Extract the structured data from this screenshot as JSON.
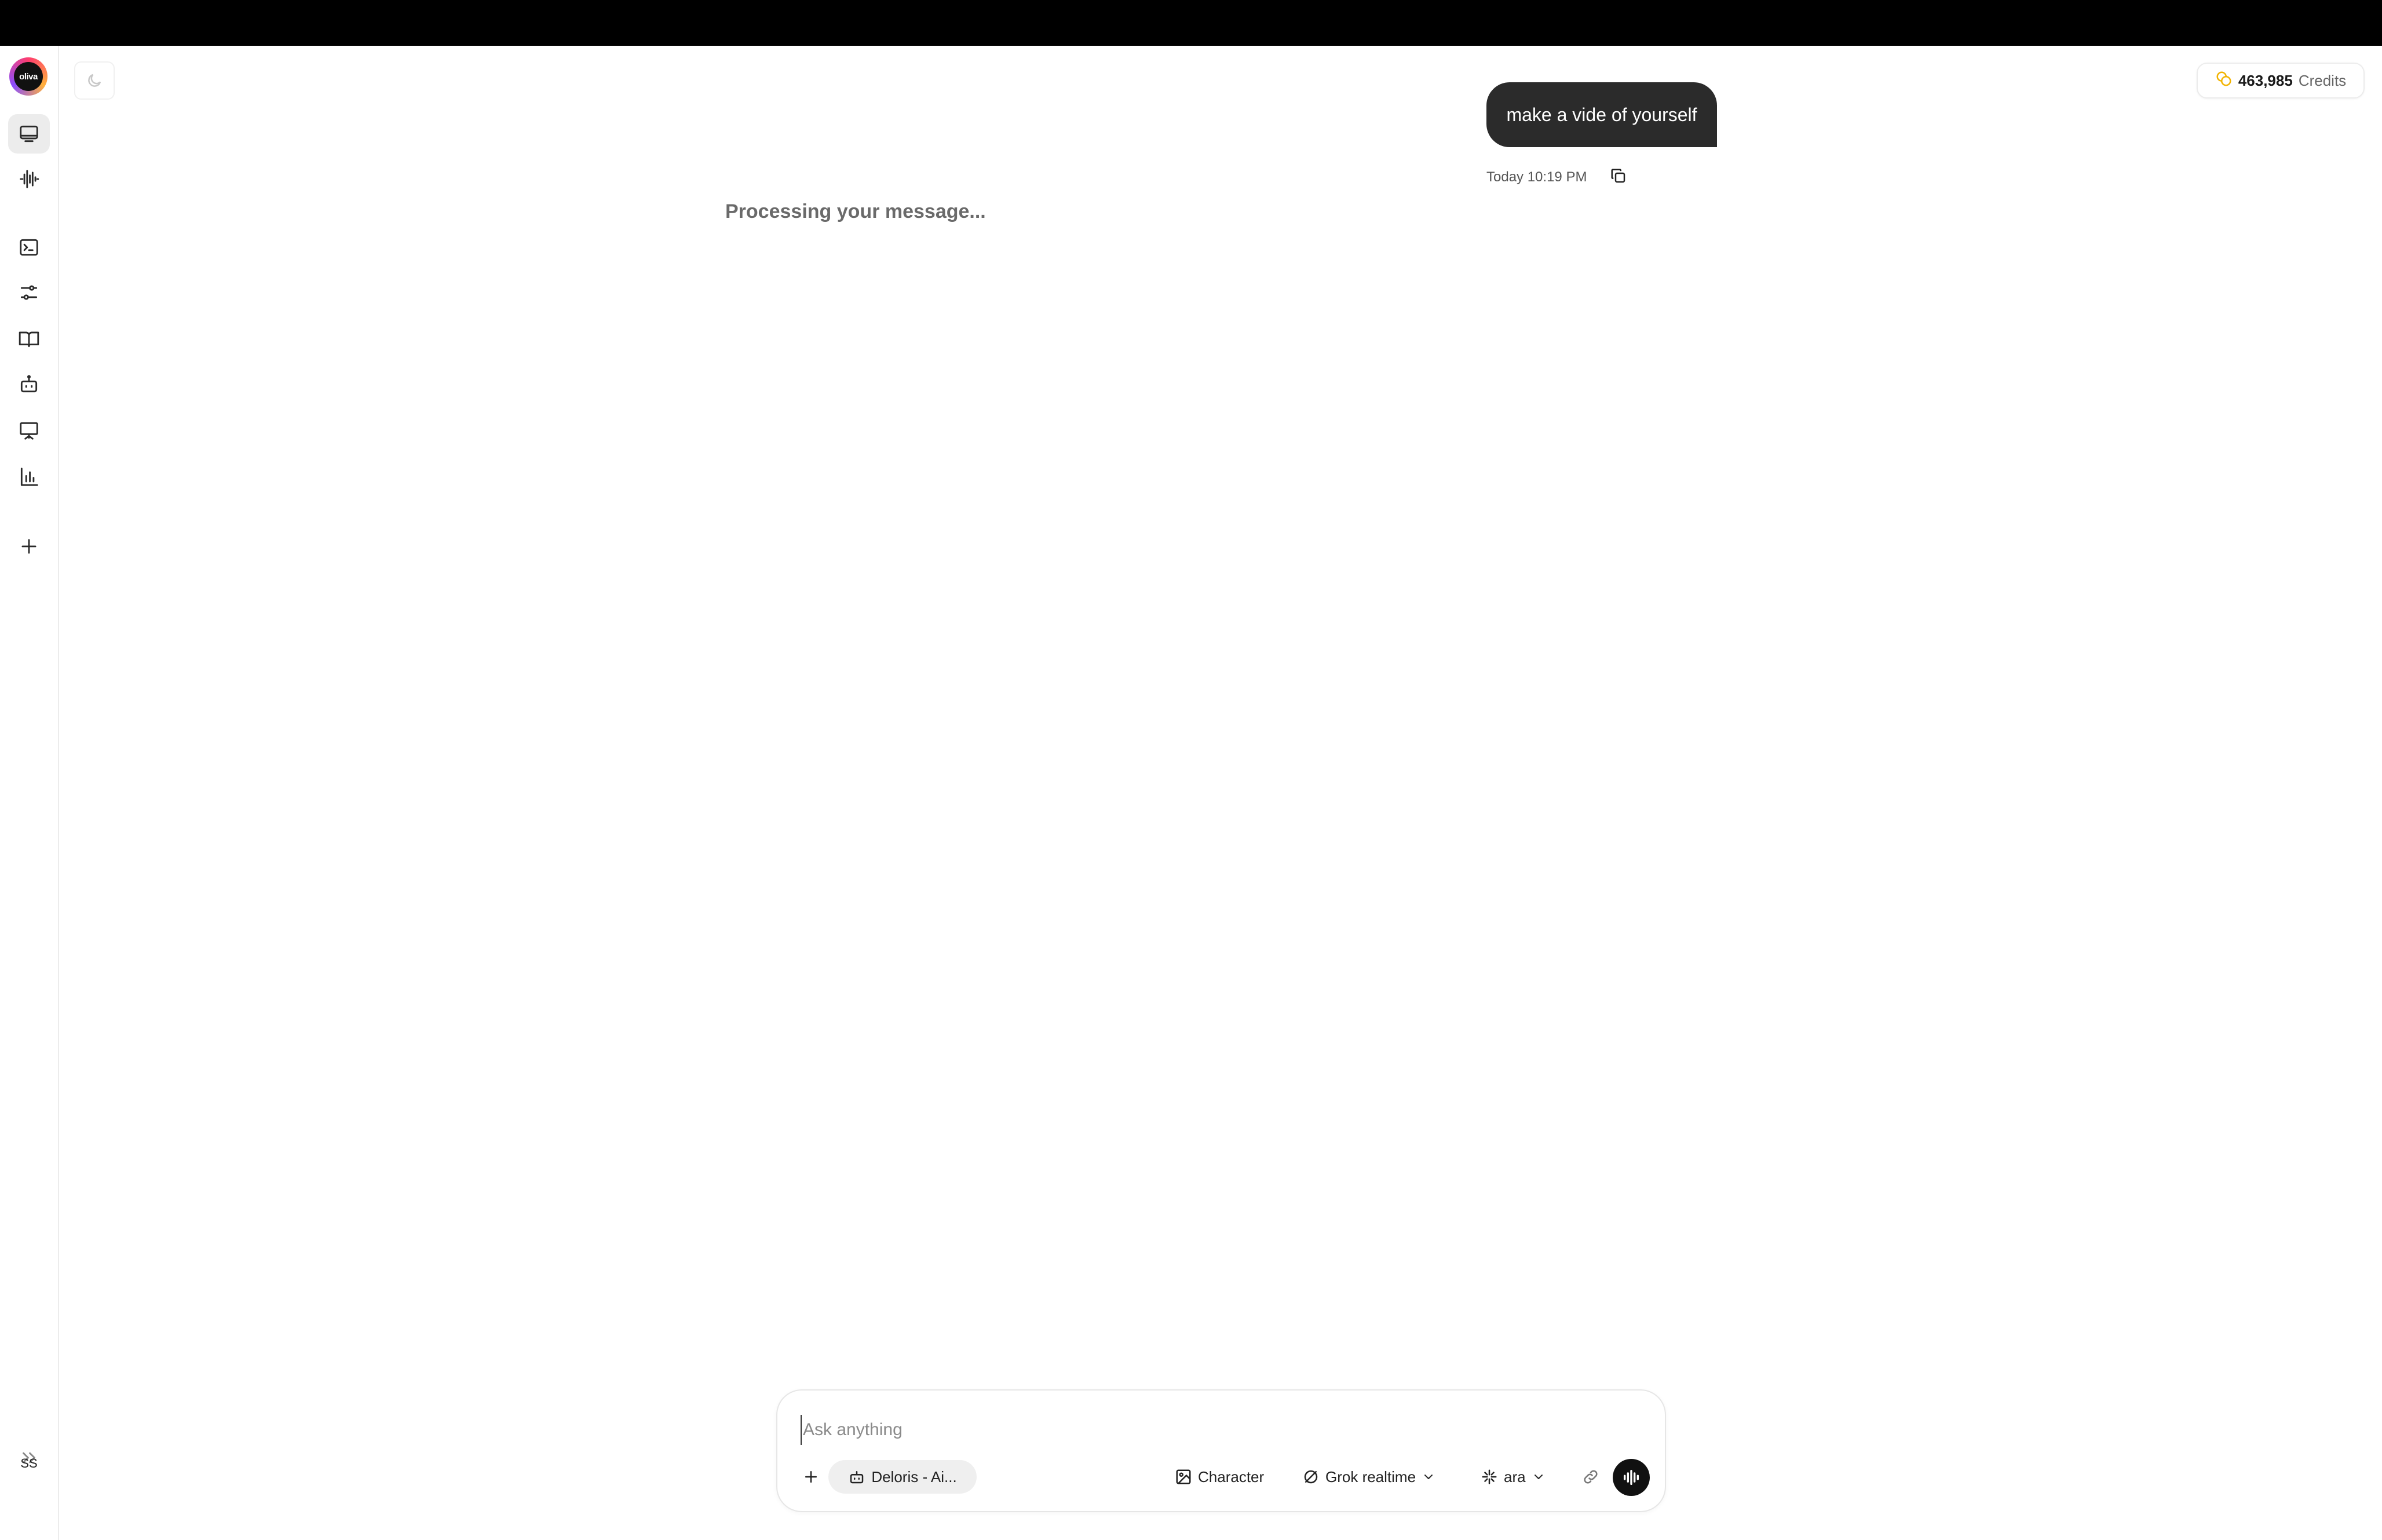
{
  "app": {
    "logo_text": "oliva"
  },
  "sidebar": {
    "items": [
      {
        "name": "chat",
        "icon": "chat-window-icon",
        "active": true
      },
      {
        "name": "audio",
        "icon": "waveform-icon"
      },
      {
        "name": "terminal",
        "icon": "terminal-icon"
      },
      {
        "name": "settings",
        "icon": "sliders-icon"
      },
      {
        "name": "library",
        "icon": "book-icon"
      },
      {
        "name": "agents",
        "icon": "robot-icon"
      },
      {
        "name": "presentation",
        "icon": "presentation-icon"
      },
      {
        "name": "analytics",
        "icon": "bar-chart-icon"
      },
      {
        "name": "new",
        "icon": "plus-icon"
      }
    ],
    "expand_icon": "double-chevron-right-icon",
    "user_initials": "SS"
  },
  "header": {
    "credits_value": "463,985",
    "credits_label": "Credits"
  },
  "conversation": {
    "user_message": "make a vide of yourself",
    "user_message_time": "Today 10:19 PM",
    "status": "Processing your message..."
  },
  "composer": {
    "placeholder": "Ask anything",
    "value": "",
    "agent_label": "Deloris - Ai...",
    "character_label": "Character",
    "model_label": "Grok realtime",
    "voice_label": "ara"
  },
  "colors": {
    "accent_dark": "#2b2b2b",
    "coin": "#f2b300",
    "background": "#ffffff"
  }
}
